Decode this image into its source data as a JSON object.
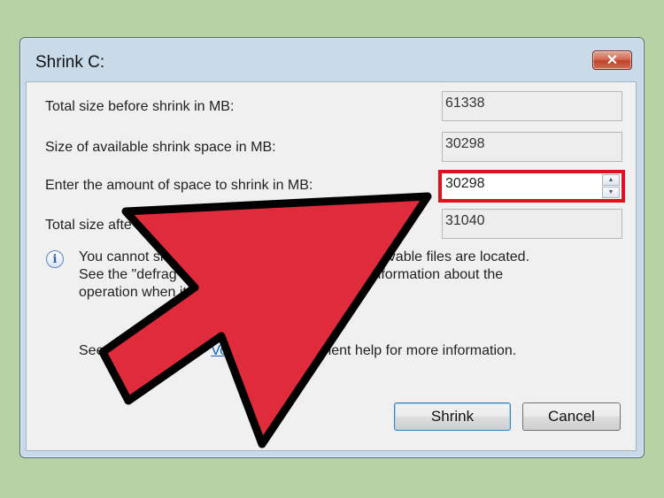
{
  "window": {
    "title": "Shrink C:",
    "close_label": "✕"
  },
  "fields": {
    "total_before_label": "Total size before shrink in MB:",
    "total_before_value": "61338",
    "available_label": "Size of available shrink space in MB:",
    "available_value": "30298",
    "amount_label": "Enter the amount of space to shrink in MB:",
    "amount_value": "30298",
    "total_after_label": "Total size afte",
    "total_after_value": "31040"
  },
  "info": {
    "icon": "i",
    "line1": "You cannot shri                              here any unmovable files are located.",
    "line2": "See the \"defrag\" e                           or detailed information about the",
    "line3": "operation when it h"
  },
  "see_more": {
    "prefix": "See",
    "link": "Volu",
    "suffix": "anagement help for more information."
  },
  "buttons": {
    "shrink": "Shrink",
    "cancel": "Cancel"
  },
  "colors": {
    "arrow": "#e02b3c",
    "highlight": "#e0111e",
    "background": "#b7d3a5"
  },
  "icons": {
    "info": "info-icon",
    "close": "close-icon",
    "spin_up": "spin-up-icon",
    "spin_down": "spin-down-icon",
    "arrow": "pointer-arrow"
  }
}
